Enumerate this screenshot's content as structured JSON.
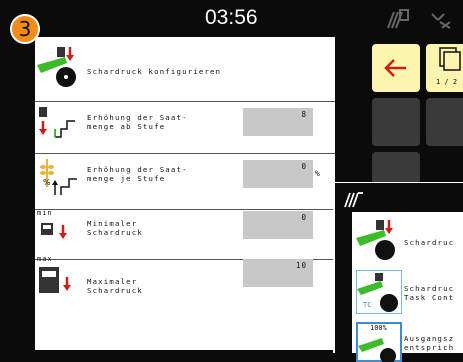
{
  "header": {
    "screen_number": "3",
    "clock": "03:56"
  },
  "main": {
    "title": "Schardruck konfigurieren",
    "rows": [
      {
        "label": "Erhöhung der Saat-\nmenge ab Stufe",
        "value": "8",
        "unit": ""
      },
      {
        "label": "Erhöhung der Saat-\nmenge je Stufe",
        "value": "0",
        "unit": "%"
      },
      {
        "label": "Minimaler\nSchardruck",
        "value": "0",
        "unit": "",
        "icon_caption": "min"
      },
      {
        "label": "Maximaler\nSchardruck",
        "value": "10",
        "unit": "",
        "icon_caption": "max"
      }
    ]
  },
  "softkeys": {
    "page_indicator": "1 / 2"
  },
  "side_menu": {
    "items": [
      {
        "label": "Schardruc"
      },
      {
        "label": "Schardruc\nTask Cont",
        "badge": "TC"
      },
      {
        "label": "Ausgangsz\nentsprich",
        "badge": "100%"
      }
    ]
  },
  "colors": {
    "accent_orange": "#f08c17",
    "implement_green": "#3dbb2a",
    "down_red": "#d01b1b",
    "softkey_active": "#fbf5b0",
    "softkey_inactive": "#3a3a3a",
    "field_grey": "#c8c8c8"
  },
  "icons": {
    "back": "arrow-left-icon",
    "pages": "stacked-pages-icon",
    "status_1": "tractor-status-icon",
    "status_2": "sensor-status-icon",
    "side_panel": "machine-rows-icon"
  }
}
